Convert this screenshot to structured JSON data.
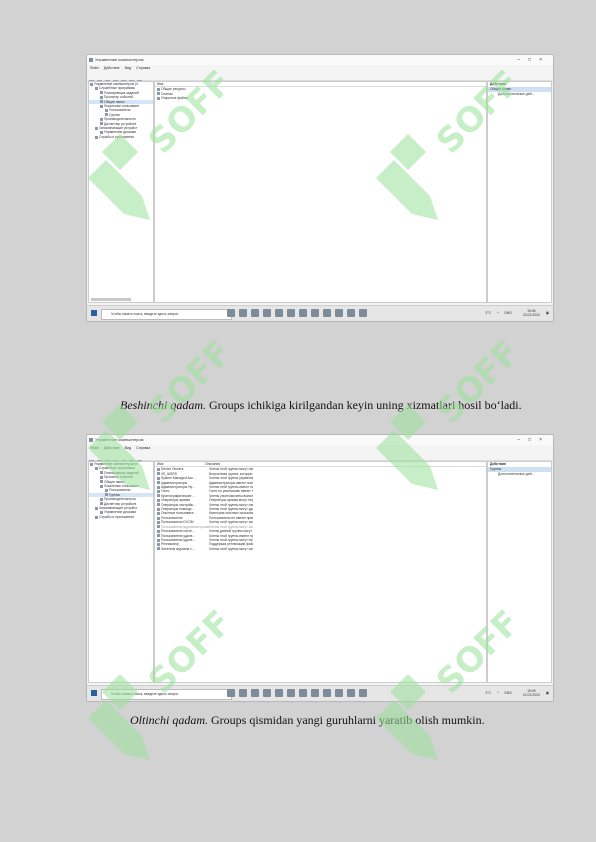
{
  "screenshot1": {
    "title": "Управление компьютером",
    "win_controls": [
      "–",
      "□",
      "×"
    ],
    "menu": [
      "Файл",
      "Действие",
      "Вид",
      "Справка"
    ],
    "tree": [
      {
        "label": "Управление компьютером (л",
        "indent": 0,
        "sel": false
      },
      {
        "label": "Служебные программы",
        "indent": 1,
        "sel": false
      },
      {
        "label": "Планировщик заданий",
        "indent": 2,
        "sel": false
      },
      {
        "label": "Просмотр событий",
        "indent": 2,
        "sel": false
      },
      {
        "label": "Общие папки",
        "indent": 2,
        "sel": true
      },
      {
        "label": "Локальные пользовате",
        "indent": 2,
        "sel": false
      },
      {
        "label": "Пользователи",
        "indent": 3,
        "sel": false
      },
      {
        "label": "Группы",
        "indent": 3,
        "sel": false
      },
      {
        "label": "Производительность",
        "indent": 2,
        "sel": false
      },
      {
        "label": "Диспетчер устройств",
        "indent": 2,
        "sel": false
      },
      {
        "label": "Запоминающие устройст",
        "indent": 1,
        "sel": false
      },
      {
        "label": "Управление дисками",
        "indent": 2,
        "sel": false
      },
      {
        "label": "Службы и приложения",
        "indent": 1,
        "sel": false
      }
    ],
    "list_header": "Имя",
    "list_items": [
      "Общие ресурсы",
      "Сеансы",
      "Открытые файлы"
    ],
    "actions": {
      "header": "Действия",
      "sub": "Общие папки",
      "item": "Дополнительные дей..."
    },
    "taskbar": {
      "search": "Чтобы начать поиск, введите здесь запрос",
      "lang": "ENG",
      "temp": "3°C",
      "time": "15:06",
      "date": "22.03.2024"
    }
  },
  "paragraph5": {
    "lead": "Beshinchi qadam.",
    "text": " Groups ichikiga kirilgandan keyin uning xizmatlari hosil bo‘ladi."
  },
  "screenshot2": {
    "title": "Управление компьютером",
    "win_controls": [
      "–",
      "□",
      "×"
    ],
    "menu": [
      "Файл",
      "Действие",
      "Вид",
      "Справка"
    ],
    "tree": [
      {
        "label": "Управление компьютером (л",
        "indent": 0,
        "sel": false
      },
      {
        "label": "Служебные программы",
        "indent": 1,
        "sel": false
      },
      {
        "label": "Планировщик заданий",
        "indent": 2,
        "sel": false
      },
      {
        "label": "Просмотр событий",
        "indent": 2,
        "sel": false
      },
      {
        "label": "Общие папки",
        "indent": 2,
        "sel": false
      },
      {
        "label": "Локальные пользовате",
        "indent": 2,
        "sel": false
      },
      {
        "label": "Пользователи",
        "indent": 3,
        "sel": false
      },
      {
        "label": "Группы",
        "indent": 3,
        "sel": true
      },
      {
        "label": "Производительность",
        "indent": 2,
        "sel": false
      },
      {
        "label": "Диспетчер устройств",
        "indent": 2,
        "sel": false
      },
      {
        "label": "Запоминающие устройст",
        "indent": 1,
        "sel": false
      },
      {
        "label": "Управление дисками",
        "indent": 2,
        "sel": false
      },
      {
        "label": "Службы и приложения",
        "indent": 1,
        "sel": false
      }
    ],
    "columns": [
      "Имя",
      "Описание"
    ],
    "rows": [
      [
        "Device Owners",
        "Члены этой группы могут измен..."
      ],
      [
        "IIS_IUSRS",
        "Встроенная группа, которую ис..."
      ],
      [
        "System Managed Acc...",
        "Члены этой группы управляются..."
      ],
      [
        "Администраторы",
        "Администраторы имеют полны..."
      ],
      [
        "Администраторы Hy...",
        "Члены этой группы имеют полн..."
      ],
      [
        "Гости",
        "Гости по умолчанию имеют те..."
      ],
      [
        "Криптографические ...",
        "Члены уполномочены выполня..."
      ],
      [
        "Операторы архива",
        "Операторы архива могут перез..."
      ],
      [
        "Операторы настройк...",
        "Члены этой группы могут изме..."
      ],
      [
        "Операторы помощи ...",
        "Члены этой группы могут удале..."
      ],
      [
        "Опытные пользовате...",
        "Категория опытных пользовате..."
      ],
      [
        "Пользователи",
        "Пользователи не имеют прав на..."
      ],
      [
        "Пользователи DCOM",
        "Члены этой группы могут запу..."
      ],
      [
        "Пользователи журналов производительности",
        "Члены этой группы могут запу..."
      ],
      [
        "Пользователи систе...",
        "Члены данной группы могут за..."
      ],
      [
        "Пользователи удале...",
        "Члены этой группы имеют прав..."
      ],
      [
        "Пользователи удале...",
        "Члены этой группы могут полу..."
      ],
      [
        "Репликатор",
        "Поддержка репликации файлов..."
      ],
      [
        "Читатели журнала с...",
        "Члены этой группы могут читат..."
      ]
    ],
    "actions": {
      "header": "Действия",
      "sub": "Группы",
      "item": "Дополнительные дей..."
    },
    "taskbar": {
      "search": "Чтобы начать поиск, введите здесь запрос",
      "lang": "ENG",
      "temp": "3°C",
      "time": "15:09",
      "date": "22.03.2024"
    }
  },
  "paragraph6": {
    "lead": "Oltinchi qadam.",
    "text": " Groups qismidan yangi guruhlarni yaratib olish mumkin."
  },
  "watermark": {
    "text": "SOFF",
    "color": "#9be29b"
  }
}
